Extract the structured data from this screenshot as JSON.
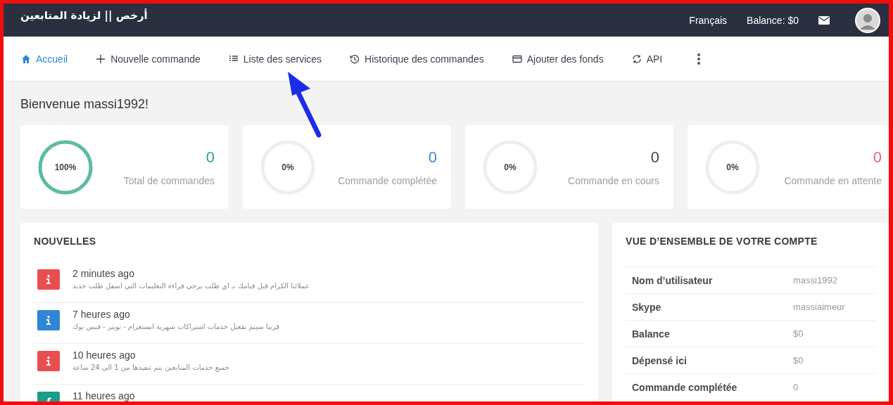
{
  "topbar": {
    "brand": "أرخص || لزيادة المتابعين",
    "language": "Français",
    "balance": "Balance: $0"
  },
  "nav": [
    {
      "label": "Accueil",
      "selected": true
    },
    {
      "label": "Nouvelle commande",
      "selected": false
    },
    {
      "label": "Liste des services",
      "selected": false
    },
    {
      "label": "Historique des commandes",
      "selected": false
    },
    {
      "label": "Ajouter des fonds",
      "selected": false
    },
    {
      "label": "API",
      "selected": false
    }
  ],
  "welcome": "Bienvenue massi1992!",
  "stats": [
    {
      "percent": "100%",
      "level": 1,
      "value": "0",
      "label": "Total de commandes",
      "color": "#26a69a"
    },
    {
      "percent": "0%",
      "level": 0,
      "value": "0",
      "label": "Commande complétée",
      "color": "#3a87d6"
    },
    {
      "percent": "0%",
      "level": 0,
      "value": "0",
      "label": "Commande en cours",
      "color": "#3d4451"
    },
    {
      "percent": "0%",
      "level": 0,
      "value": "0",
      "label": "Commande en attente",
      "color": "#e8608a"
    }
  ],
  "news": {
    "title": "NOUVELLES",
    "items": [
      {
        "time": "2 minutes ago",
        "text": "عملائنا الكرام قبل قيامك بـ اي طلب يرجى قراءة التعليمات التي اسفل طلب جديد",
        "kind": "info",
        "color": "#e94e4e"
      },
      {
        "time": "7 heures ago",
        "text": "قريبا سيتم تفعيل خدمات اشتراكات شهرية انستغرام - تويتر - فيس بوك",
        "kind": "info",
        "color": "#2f86d6"
      },
      {
        "time": "10 heures ago",
        "text": "جميع خدمات المتابعين يتم تنفيذها من 1 الى 24 ساعة",
        "kind": "info",
        "color": "#e94e4e"
      },
      {
        "time": "11 heures ago",
        "kind": "facebook",
        "color": "#1a9e8a"
      }
    ]
  },
  "account": {
    "title": "VUE D’ENSEMBLE DE VOTRE COMPTE",
    "rows": [
      {
        "label": "Nom d’utilisateur",
        "value": "massi1992"
      },
      {
        "label": "Skype",
        "value": "massiaimeur"
      },
      {
        "label": "Balance",
        "value": "$0"
      },
      {
        "label": "Dépensé ici",
        "value": "$0"
      },
      {
        "label": "Commande complétée",
        "value": "0"
      }
    ]
  }
}
